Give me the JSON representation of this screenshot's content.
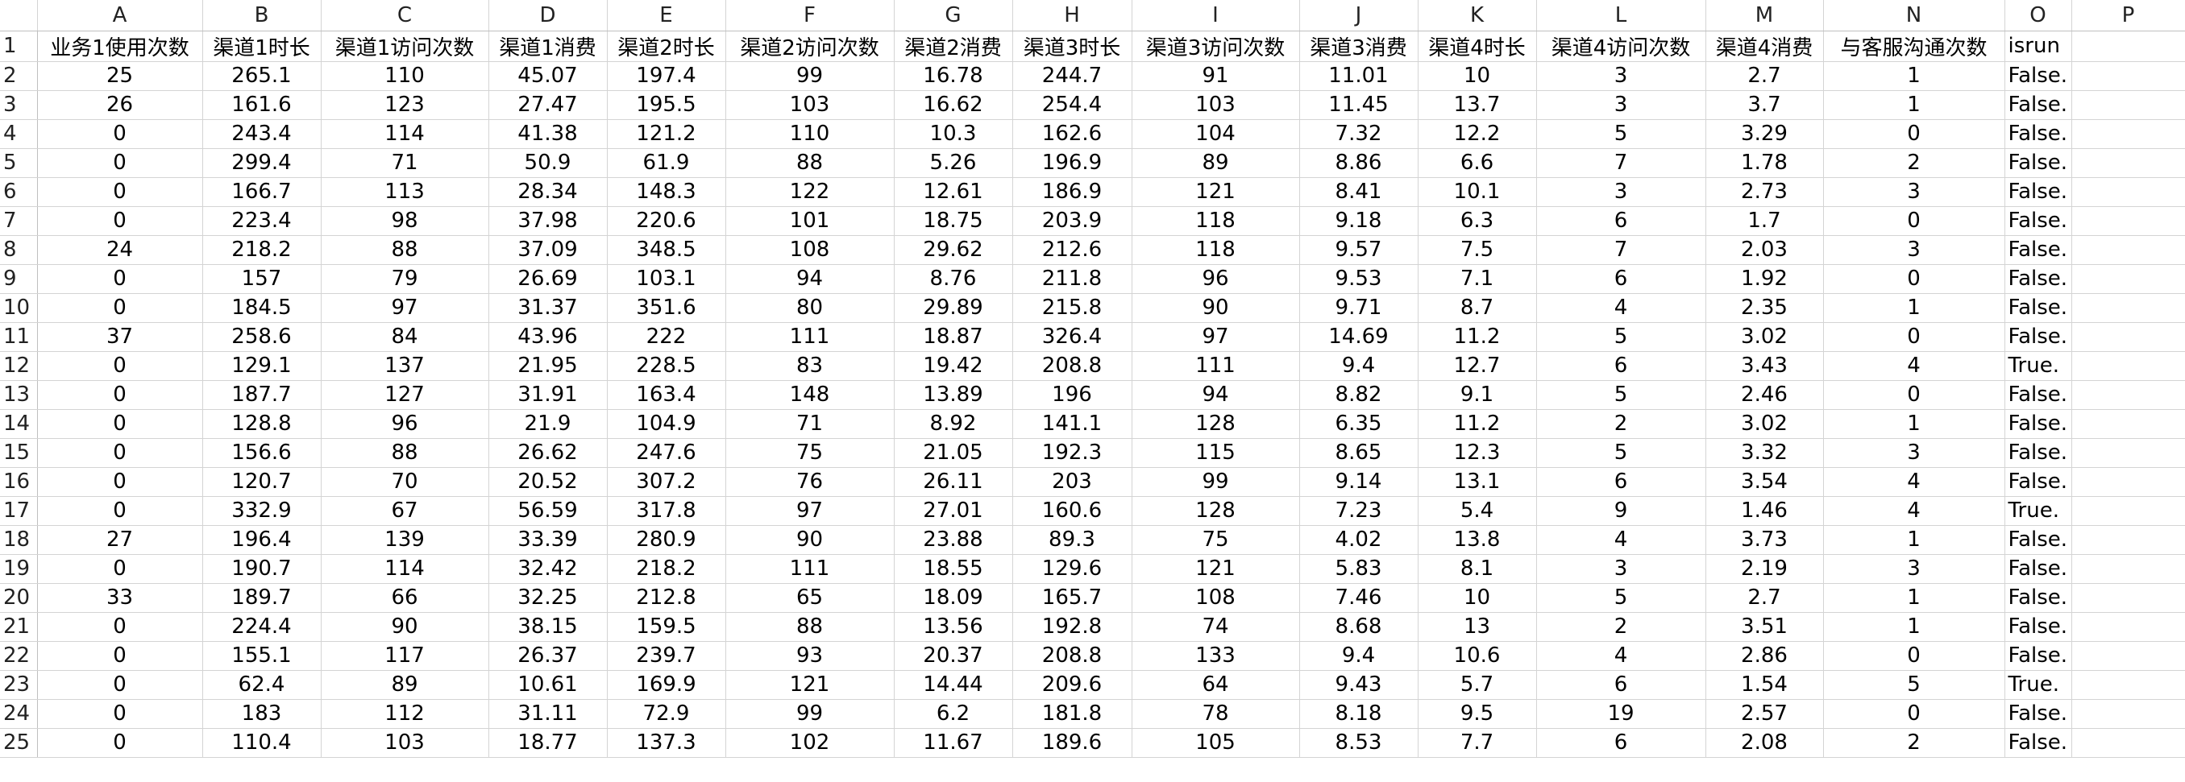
{
  "columns": [
    "A",
    "B",
    "C",
    "D",
    "E",
    "F",
    "G",
    "H",
    "I",
    "J",
    "K",
    "L",
    "M",
    "N",
    "O",
    "P"
  ],
  "header_row": {
    "row_number": "1",
    "cells": [
      "业务1使用次数",
      "渠道1时长",
      "渠道1访问次数",
      "渠道1消费",
      "渠道2时长",
      "渠道2访问次数",
      "渠道2消费",
      "渠道3时长",
      "渠道3访问次数",
      "渠道3消费",
      "渠道4时长",
      "渠道4访问次数",
      "渠道4消费",
      "与客服沟通次数",
      "isrun",
      ""
    ]
  },
  "rows": [
    {
      "n": "2",
      "cells": [
        "25",
        "265.1",
        "110",
        "45.07",
        "197.4",
        "99",
        "16.78",
        "244.7",
        "91",
        "11.01",
        "10",
        "3",
        "2.7",
        "1",
        "False.",
        ""
      ]
    },
    {
      "n": "3",
      "cells": [
        "26",
        "161.6",
        "123",
        "27.47",
        "195.5",
        "103",
        "16.62",
        "254.4",
        "103",
        "11.45",
        "13.7",
        "3",
        "3.7",
        "1",
        "False.",
        ""
      ]
    },
    {
      "n": "4",
      "cells": [
        "0",
        "243.4",
        "114",
        "41.38",
        "121.2",
        "110",
        "10.3",
        "162.6",
        "104",
        "7.32",
        "12.2",
        "5",
        "3.29",
        "0",
        "False.",
        ""
      ]
    },
    {
      "n": "5",
      "cells": [
        "0",
        "299.4",
        "71",
        "50.9",
        "61.9",
        "88",
        "5.26",
        "196.9",
        "89",
        "8.86",
        "6.6",
        "7",
        "1.78",
        "2",
        "False.",
        ""
      ]
    },
    {
      "n": "6",
      "cells": [
        "0",
        "166.7",
        "113",
        "28.34",
        "148.3",
        "122",
        "12.61",
        "186.9",
        "121",
        "8.41",
        "10.1",
        "3",
        "2.73",
        "3",
        "False.",
        ""
      ]
    },
    {
      "n": "7",
      "cells": [
        "0",
        "223.4",
        "98",
        "37.98",
        "220.6",
        "101",
        "18.75",
        "203.9",
        "118",
        "9.18",
        "6.3",
        "6",
        "1.7",
        "0",
        "False.",
        ""
      ]
    },
    {
      "n": "8",
      "cells": [
        "24",
        "218.2",
        "88",
        "37.09",
        "348.5",
        "108",
        "29.62",
        "212.6",
        "118",
        "9.57",
        "7.5",
        "7",
        "2.03",
        "3",
        "False.",
        ""
      ]
    },
    {
      "n": "9",
      "cells": [
        "0",
        "157",
        "79",
        "26.69",
        "103.1",
        "94",
        "8.76",
        "211.8",
        "96",
        "9.53",
        "7.1",
        "6",
        "1.92",
        "0",
        "False.",
        ""
      ]
    },
    {
      "n": "10",
      "cells": [
        "0",
        "184.5",
        "97",
        "31.37",
        "351.6",
        "80",
        "29.89",
        "215.8",
        "90",
        "9.71",
        "8.7",
        "4",
        "2.35",
        "1",
        "False.",
        ""
      ]
    },
    {
      "n": "11",
      "cells": [
        "37",
        "258.6",
        "84",
        "43.96",
        "222",
        "111",
        "18.87",
        "326.4",
        "97",
        "14.69",
        "11.2",
        "5",
        "3.02",
        "0",
        "False.",
        ""
      ]
    },
    {
      "n": "12",
      "cells": [
        "0",
        "129.1",
        "137",
        "21.95",
        "228.5",
        "83",
        "19.42",
        "208.8",
        "111",
        "9.4",
        "12.7",
        "6",
        "3.43",
        "4",
        "True.",
        ""
      ]
    },
    {
      "n": "13",
      "cells": [
        "0",
        "187.7",
        "127",
        "31.91",
        "163.4",
        "148",
        "13.89",
        "196",
        "94",
        "8.82",
        "9.1",
        "5",
        "2.46",
        "0",
        "False.",
        ""
      ]
    },
    {
      "n": "14",
      "cells": [
        "0",
        "128.8",
        "96",
        "21.9",
        "104.9",
        "71",
        "8.92",
        "141.1",
        "128",
        "6.35",
        "11.2",
        "2",
        "3.02",
        "1",
        "False.",
        ""
      ]
    },
    {
      "n": "15",
      "cells": [
        "0",
        "156.6",
        "88",
        "26.62",
        "247.6",
        "75",
        "21.05",
        "192.3",
        "115",
        "8.65",
        "12.3",
        "5",
        "3.32",
        "3",
        "False.",
        ""
      ]
    },
    {
      "n": "16",
      "cells": [
        "0",
        "120.7",
        "70",
        "20.52",
        "307.2",
        "76",
        "26.11",
        "203",
        "99",
        "9.14",
        "13.1",
        "6",
        "3.54",
        "4",
        "False.",
        ""
      ]
    },
    {
      "n": "17",
      "cells": [
        "0",
        "332.9",
        "67",
        "56.59",
        "317.8",
        "97",
        "27.01",
        "160.6",
        "128",
        "7.23",
        "5.4",
        "9",
        "1.46",
        "4",
        "True.",
        ""
      ]
    },
    {
      "n": "18",
      "cells": [
        "27",
        "196.4",
        "139",
        "33.39",
        "280.9",
        "90",
        "23.88",
        "89.3",
        "75",
        "4.02",
        "13.8",
        "4",
        "3.73",
        "1",
        "False.",
        ""
      ]
    },
    {
      "n": "19",
      "cells": [
        "0",
        "190.7",
        "114",
        "32.42",
        "218.2",
        "111",
        "18.55",
        "129.6",
        "121",
        "5.83",
        "8.1",
        "3",
        "2.19",
        "3",
        "False.",
        ""
      ]
    },
    {
      "n": "20",
      "cells": [
        "33",
        "189.7",
        "66",
        "32.25",
        "212.8",
        "65",
        "18.09",
        "165.7",
        "108",
        "7.46",
        "10",
        "5",
        "2.7",
        "1",
        "False.",
        ""
      ]
    },
    {
      "n": "21",
      "cells": [
        "0",
        "224.4",
        "90",
        "38.15",
        "159.5",
        "88",
        "13.56",
        "192.8",
        "74",
        "8.68",
        "13",
        "2",
        "3.51",
        "1",
        "False.",
        ""
      ]
    },
    {
      "n": "22",
      "cells": [
        "0",
        "155.1",
        "117",
        "26.37",
        "239.7",
        "93",
        "20.37",
        "208.8",
        "133",
        "9.4",
        "10.6",
        "4",
        "2.86",
        "0",
        "False.",
        ""
      ]
    },
    {
      "n": "23",
      "cells": [
        "0",
        "62.4",
        "89",
        "10.61",
        "169.9",
        "121",
        "14.44",
        "209.6",
        "64",
        "9.43",
        "5.7",
        "6",
        "1.54",
        "5",
        "True.",
        ""
      ]
    },
    {
      "n": "24",
      "cells": [
        "0",
        "183",
        "112",
        "31.11",
        "72.9",
        "99",
        "6.2",
        "181.8",
        "78",
        "8.18",
        "9.5",
        "19",
        "2.57",
        "0",
        "False.",
        ""
      ]
    },
    {
      "n": "25",
      "cells": [
        "0",
        "110.4",
        "103",
        "18.77",
        "137.3",
        "102",
        "11.67",
        "189.6",
        "105",
        "8.53",
        "7.7",
        "6",
        "2.08",
        "2",
        "False.",
        ""
      ]
    }
  ]
}
